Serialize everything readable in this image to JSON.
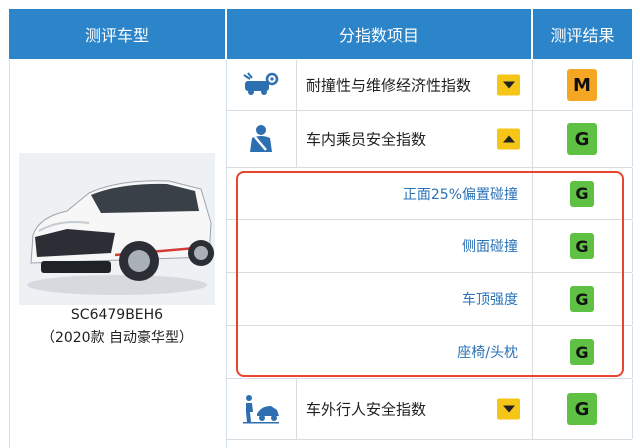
{
  "header": {
    "model_col": "测评车型",
    "index_col": "分指数项目",
    "result_col": "测评结果"
  },
  "vehicle": {
    "model_code": "SC6479BEH6",
    "description": "（2020款 自动豪华型）"
  },
  "rows": [
    {
      "label": "耐撞性与维修经济性指数",
      "result": "M",
      "result_color": "#f5a623",
      "toggle": "chevron-down-icon",
      "icon": "repair-icon"
    },
    {
      "label": "车内乘员安全指数",
      "result": "G",
      "result_color": "#5ec143",
      "toggle": "chevron-up-icon",
      "icon": "seatbelt-icon"
    },
    {
      "label": "车外行人安全指数",
      "result": "G",
      "result_color": "#5ec143",
      "toggle": "chevron-down-icon",
      "icon": "pedestrian-icon"
    }
  ],
  "subrows": [
    {
      "label": "正面25%偏置碰撞",
      "result": "G"
    },
    {
      "label": "侧面碰撞",
      "result": "G"
    },
    {
      "label": "车顶强度",
      "result": "G"
    },
    {
      "label": "座椅/头枕",
      "result": "G"
    }
  ],
  "colors": {
    "header_bg": "#2c84c9",
    "subrow_text": "#2a73b8",
    "highlight_border": "#e8442e",
    "toggle_bg": "#f5c518"
  }
}
